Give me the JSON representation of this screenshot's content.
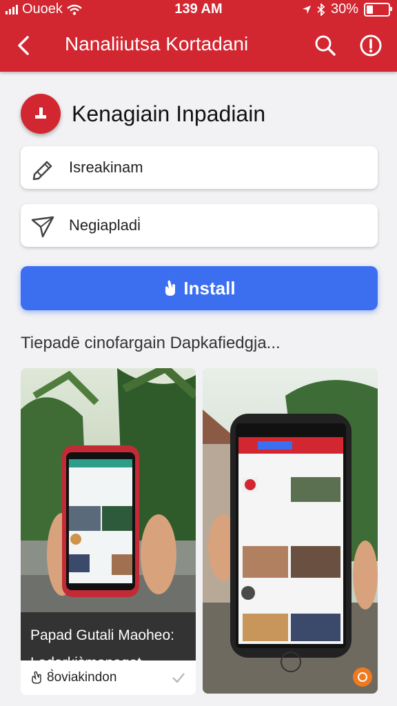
{
  "status_bar": {
    "carrier": "Ouoek",
    "time": "139 AM",
    "battery": "30%",
    "battery_level": 0.3
  },
  "app_bar": {
    "title": "Nanaliiutsa Kortadani",
    "back_icon": "back-arrow-icon",
    "search_icon": "search-icon",
    "info_icon": "alert-icon"
  },
  "app": {
    "name": "Kenagiain Inpadiain",
    "icon": "app-logo-icon"
  },
  "fields": [
    {
      "label": "Isreakinam",
      "icon": "pen-icon"
    },
    {
      "label": "Negiapladi̇",
      "icon": "send-icon"
    }
  ],
  "install_button": {
    "label": "Install",
    "icon": "hand-icon"
  },
  "section_title": "Tiepadē cinofargain Dapkafiedgja...",
  "screenshots": [
    {
      "caption_line1": "Papad Gutali Maoheo:",
      "caption_line2": "Ladarkis̀monagat",
      "footer": "8̀oviakindon"
    },
    {
      "caption_line1": "",
      "caption_line2": "",
      "footer": ""
    }
  ],
  "colors": {
    "brand": "#d22630",
    "accent": "#3b6ff0",
    "background": "#f2f2f4"
  }
}
